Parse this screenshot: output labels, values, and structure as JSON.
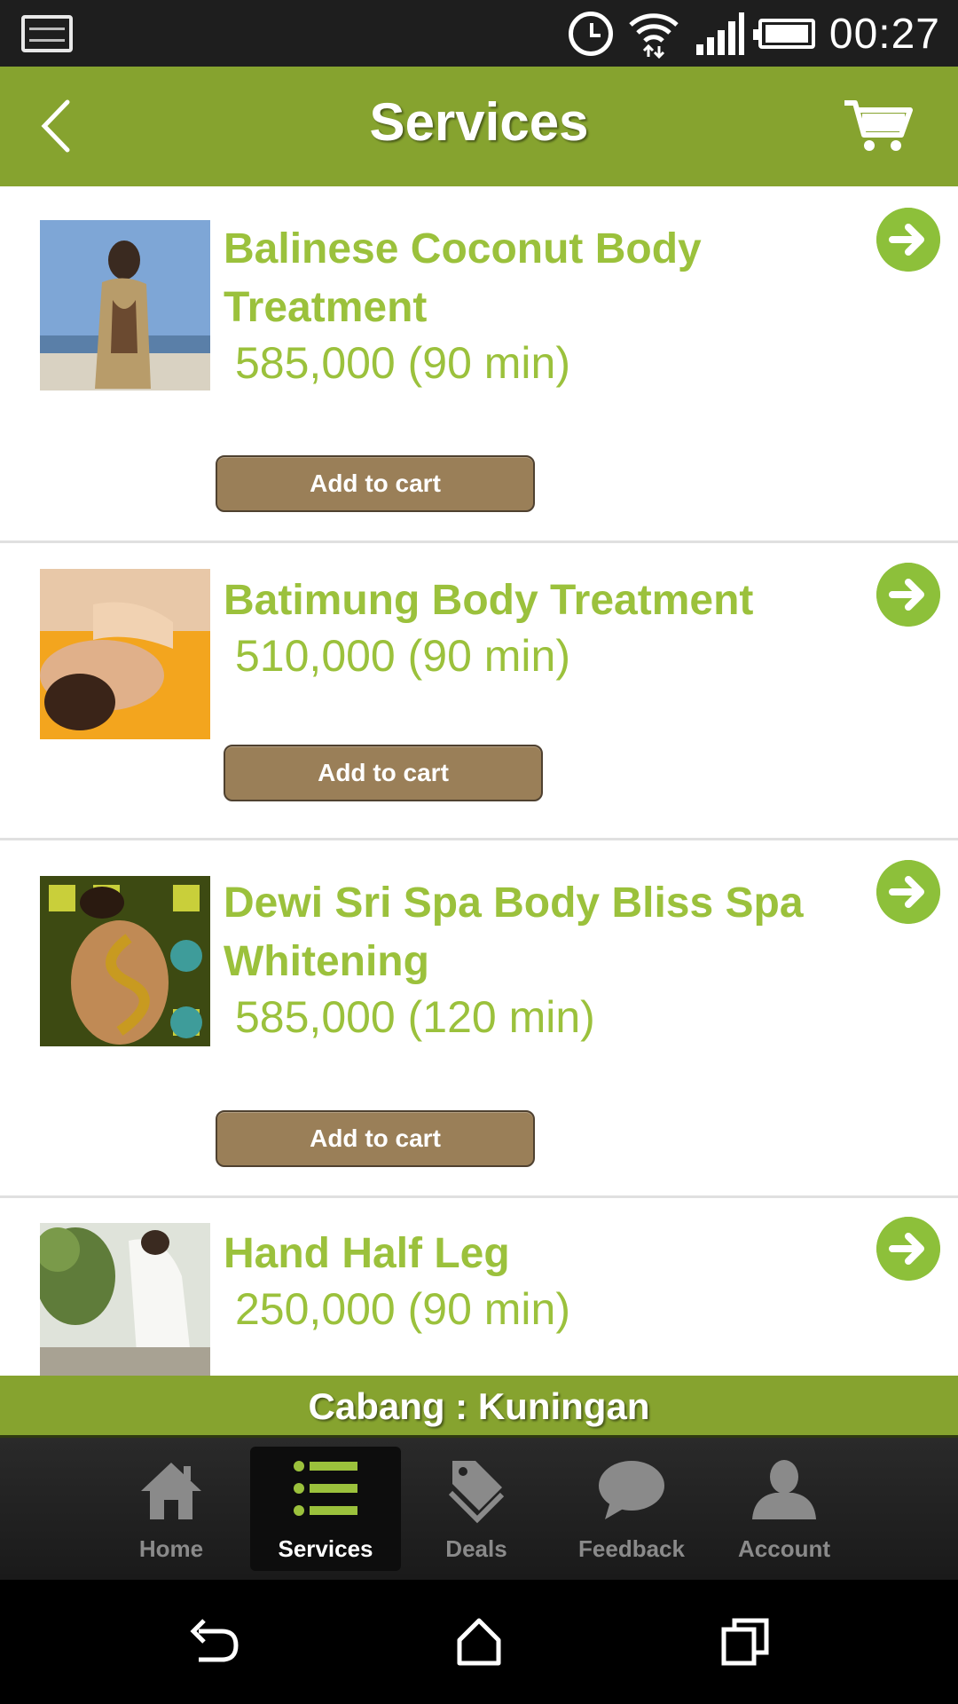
{
  "status_bar": {
    "time": "00:27"
  },
  "header": {
    "title": "Services"
  },
  "services": [
    {
      "name": "Balinese Coconut Body Treatment",
      "price": "585,000 (90 min)",
      "button": "Add to cart"
    },
    {
      "name": "Batimung Body Treatment",
      "price": "510,000 (90 min)",
      "button": "Add to cart"
    },
    {
      "name": "Dewi Sri Spa Body Bliss Spa Whitening",
      "price": "585,000 (120 min)",
      "button": "Add to cart"
    },
    {
      "name": "Hand Half Leg",
      "price": "250,000 (90 min)",
      "button": ""
    }
  ],
  "branch": {
    "label": "Cabang : Kuningan"
  },
  "tabs": [
    {
      "label": "Home",
      "icon": "home-icon"
    },
    {
      "label": "Services",
      "icon": "list-icon"
    },
    {
      "label": "Deals",
      "icon": "tags-icon"
    },
    {
      "label": "Feedback",
      "icon": "chat-bubble-icon"
    },
    {
      "label": "Account",
      "icon": "person-icon"
    }
  ],
  "colors": {
    "header_green": "#86a32f",
    "text_green": "#9bc13c",
    "button_brown": "#9a7f58"
  }
}
